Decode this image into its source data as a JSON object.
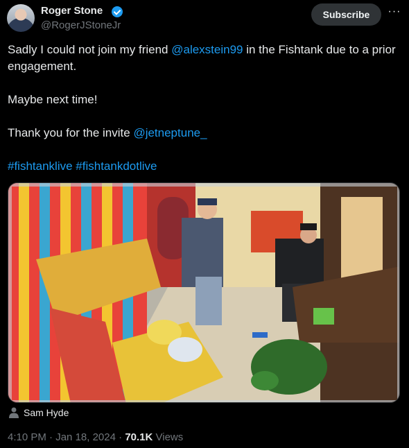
{
  "author": {
    "name": "Roger Stone",
    "handle": "@RogerJStoneJr",
    "verified": true,
    "avatar_icon": "avatar"
  },
  "actions": {
    "subscribe_label": "Subscribe",
    "more_label": "···"
  },
  "tweet": {
    "line1_pre": "Sadly I could not join my friend ",
    "line1_mention": "@alexstein99",
    "line1_post": " in the Fishtank due to a prior engagement.",
    "line2": "Maybe next time!",
    "line3_pre": "Thank you for the invite ",
    "line3_mention": "@jetneptune_",
    "hashtag1": "#fishtanklive",
    "hashtag2": "#fishtankdotlive"
  },
  "media": {
    "tagged_person": "Sam Hyde",
    "tagged_icon": "person-icon"
  },
  "meta": {
    "time": "4:10 PM",
    "separator": " · ",
    "date": "Jan 18, 2024",
    "views_count": "70.1K",
    "views_label": " Views"
  },
  "colors": {
    "background": "#000000",
    "text": "#e7e9ea",
    "secondary": "#71767b",
    "link": "#1d9bf0",
    "verified": "#1d9bf0"
  }
}
